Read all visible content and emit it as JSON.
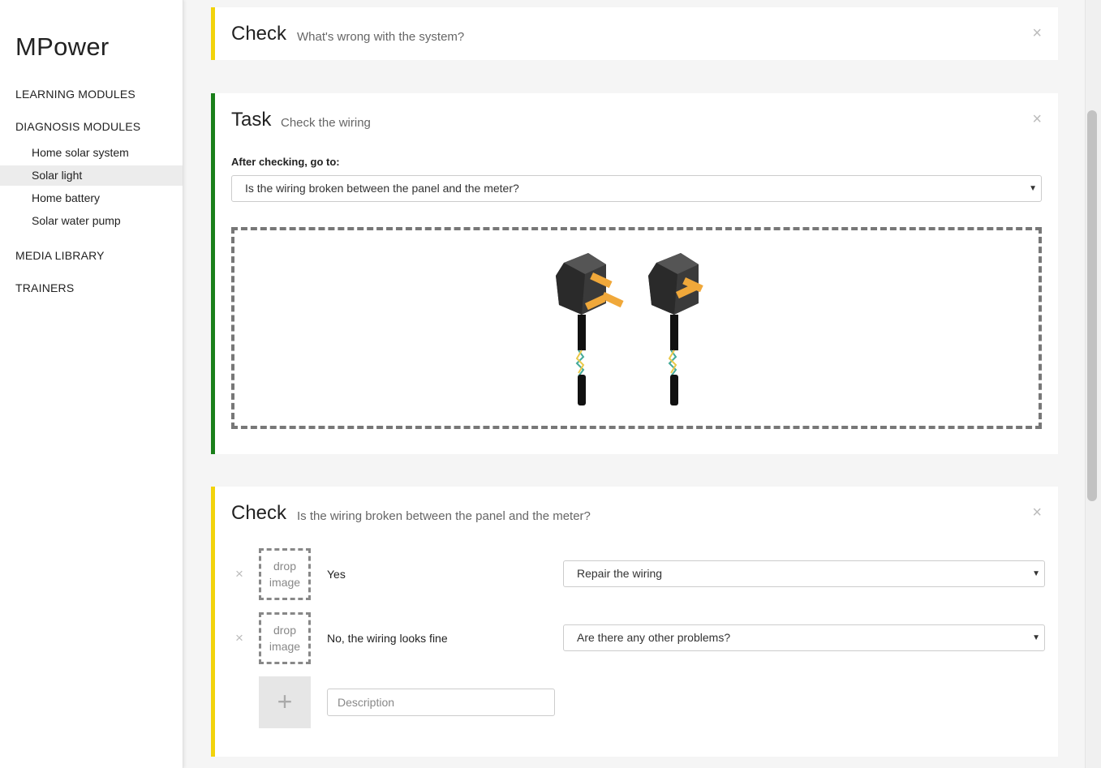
{
  "sidebar": {
    "brand": "MPower",
    "sections": {
      "learning": "LEARNING MODULES",
      "diagnosis": "DIAGNOSIS MODULES",
      "media": "MEDIA LIBRARY",
      "trainers": "TRAINERS"
    },
    "diagnosis_items": [
      "Home solar system",
      "Solar light",
      "Home battery",
      "Solar water pump"
    ],
    "active_item": "Solar light"
  },
  "cards": {
    "check1": {
      "title": "Check",
      "subtitle": "What's wrong with the system?"
    },
    "task": {
      "title": "Task",
      "subtitle": "Check the wiring",
      "goto_label": "After checking, go to:",
      "goto_value": "Is the wiring broken between the panel and the meter?"
    },
    "check2": {
      "title": "Check",
      "subtitle": "Is the wiring broken between the panel and the meter?",
      "options": [
        {
          "drop_line1": "drop",
          "drop_line2": "image",
          "answer": "Yes",
          "next": "Repair the wiring"
        },
        {
          "drop_line1": "drop",
          "drop_line2": "image",
          "answer": "No, the wiring looks fine",
          "next": "Are there any other problems?"
        }
      ],
      "add_icon": "+",
      "description_placeholder": "Description"
    }
  },
  "icons": {
    "close": "×",
    "caret": "▼"
  },
  "colors": {
    "check_accent": "#f2d30b",
    "task_accent": "#1a7f1a"
  }
}
